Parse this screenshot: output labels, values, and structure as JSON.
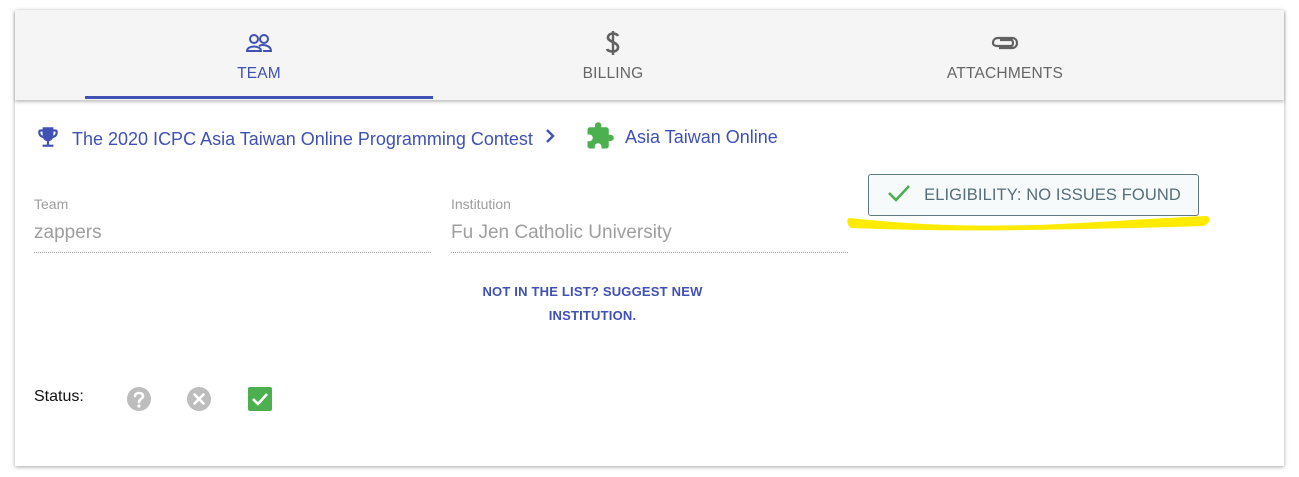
{
  "tabs": [
    {
      "label": "TEAM",
      "icon": "team-icon",
      "active": true
    },
    {
      "label": "BILLING",
      "icon": "dollar-icon",
      "active": false
    },
    {
      "label": "ATTACHMENTS",
      "icon": "paperclip-icon",
      "active": false
    }
  ],
  "breadcrumb": {
    "contest": "The 2020 ICPC Asia Taiwan Online Programming Contest",
    "site": "Asia Taiwan Online"
  },
  "form": {
    "team_label": "Team",
    "team_value": "zappers",
    "institution_label": "Institution",
    "institution_value": "Fu Jen Catholic University",
    "suggest_line1": "NOT IN THE LIST? SUGGEST NEW",
    "suggest_line2": "INSTITUTION."
  },
  "eligibility": {
    "label": "ELIGIBILITY: NO ISSUES FOUND"
  },
  "status": {
    "label": "Status:",
    "options": [
      "question-icon",
      "x-circle-icon",
      "checkbox-checked-icon"
    ]
  },
  "colors": {
    "accent": "#3f51b5",
    "success": "#4caf50",
    "highlight": "#ffeb00",
    "muted": "#9e9e9e"
  }
}
